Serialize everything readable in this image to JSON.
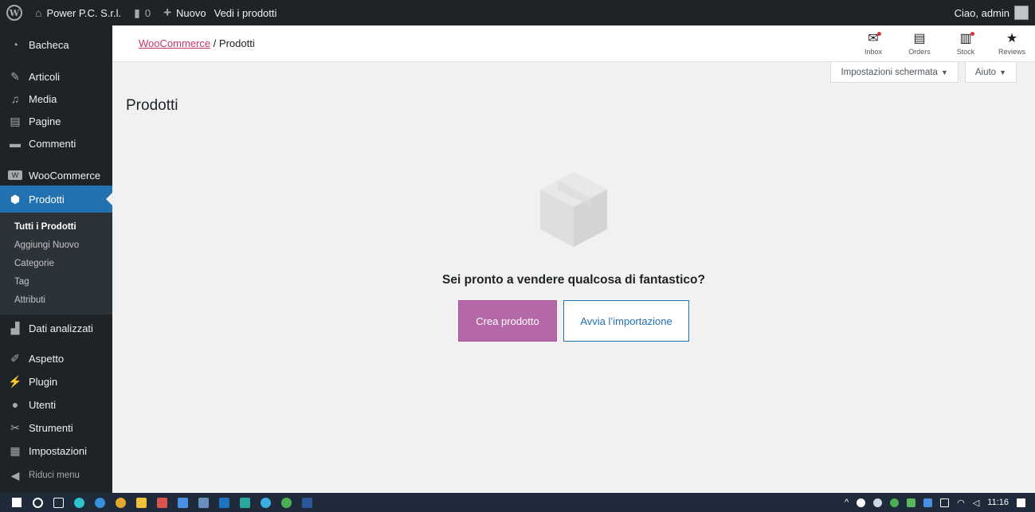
{
  "adminbar": {
    "site_name": "Power P.C. S.r.l.",
    "comments_count": "0",
    "new_label": "Nuovo",
    "view_products": "Vedi i prodotti",
    "greeting": "Ciao, admin"
  },
  "sidebar": {
    "items": [
      {
        "label": "Bacheca",
        "icon": "dashboard-icon"
      },
      {
        "label": "Articoli",
        "icon": "pin-icon"
      },
      {
        "label": "Media",
        "icon": "media-icon"
      },
      {
        "label": "Pagine",
        "icon": "page-icon"
      },
      {
        "label": "Commenti",
        "icon": "comment-icon"
      },
      {
        "label": "WooCommerce",
        "icon": "woo-icon"
      },
      {
        "label": "Prodotti",
        "icon": "product-icon"
      },
      {
        "label": "Dati analizzati",
        "icon": "analytics-icon"
      },
      {
        "label": "Aspetto",
        "icon": "brush-icon"
      },
      {
        "label": "Plugin",
        "icon": "plugin-icon"
      },
      {
        "label": "Utenti",
        "icon": "users-icon"
      },
      {
        "label": "Strumenti",
        "icon": "tools-icon"
      },
      {
        "label": "Impostazioni",
        "icon": "settings-icon"
      }
    ],
    "submenu": [
      "Tutti i Prodotti",
      "Aggiungi Nuovo",
      "Categorie",
      "Tag",
      "Attributi"
    ],
    "collapse": "Riduci menu"
  },
  "header": {
    "breadcrumb_link": "WooCommerce",
    "breadcrumb_sep": " / ",
    "breadcrumb_current": "Prodotti",
    "actions": [
      "Inbox",
      "Orders",
      "Stock",
      "Reviews"
    ]
  },
  "screen_options": {
    "screen": "Impostazioni schermata",
    "help": "Aiuto"
  },
  "page": {
    "title": "Prodotti",
    "empty_message": "Sei pronto a vendere qualcosa di fantastico?",
    "create_button": "Crea prodotto",
    "import_button": "Avvia l’importazione"
  },
  "taskbar": {
    "time": "11:16"
  },
  "colors": {
    "primary": "#b568a8",
    "wp_blue": "#2271b1",
    "admin_dark": "#1d2327"
  }
}
